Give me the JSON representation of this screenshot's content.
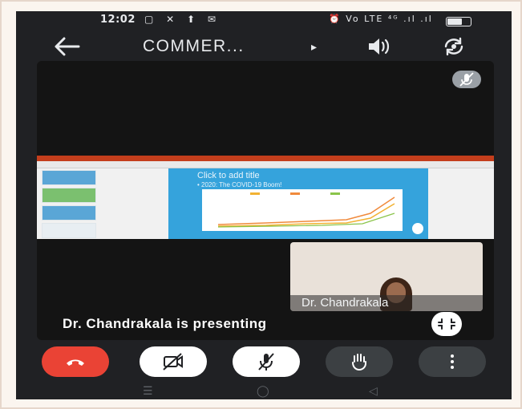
{
  "status_bar": {
    "time": "12:02",
    "left_icons": "▢ ✕ ⬆ ✉",
    "right_icons": "⏰ Vo LTE ⁴ᴳ .ıl .ıl"
  },
  "header": {
    "back_icon": "arrow-left-icon",
    "title": "COMMER...",
    "caret": "▸",
    "speaker_icon": "speaker-icon",
    "flip_camera_icon": "flip-camera-icon"
  },
  "presentation": {
    "slide_title": "Click to add title",
    "slide_bullet": "• 2020: The COVID-19 Boom!",
    "mic_muted_icon": "mic-off-icon"
  },
  "participant": {
    "name_label": "Dr. Chandrakala"
  },
  "status_message": "Dr. Chandrakala is presenting",
  "controls": [
    {
      "name": "end-call-button",
      "icon": "phone-hangup-icon",
      "color": "#ea4335"
    },
    {
      "name": "camera-toggle-button",
      "icon": "camera-off-icon",
      "color": "#ffffff"
    },
    {
      "name": "mic-toggle-button",
      "icon": "mic-off-icon",
      "color": "#ffffff"
    },
    {
      "name": "raise-hand-button",
      "icon": "hand-icon",
      "color": "#3c4043"
    },
    {
      "name": "more-options-button",
      "icon": "more-vertical-icon",
      "color": "#3c4043"
    }
  ],
  "nav_bar": {
    "recents": "☰",
    "home": "◯",
    "back": "◁"
  }
}
